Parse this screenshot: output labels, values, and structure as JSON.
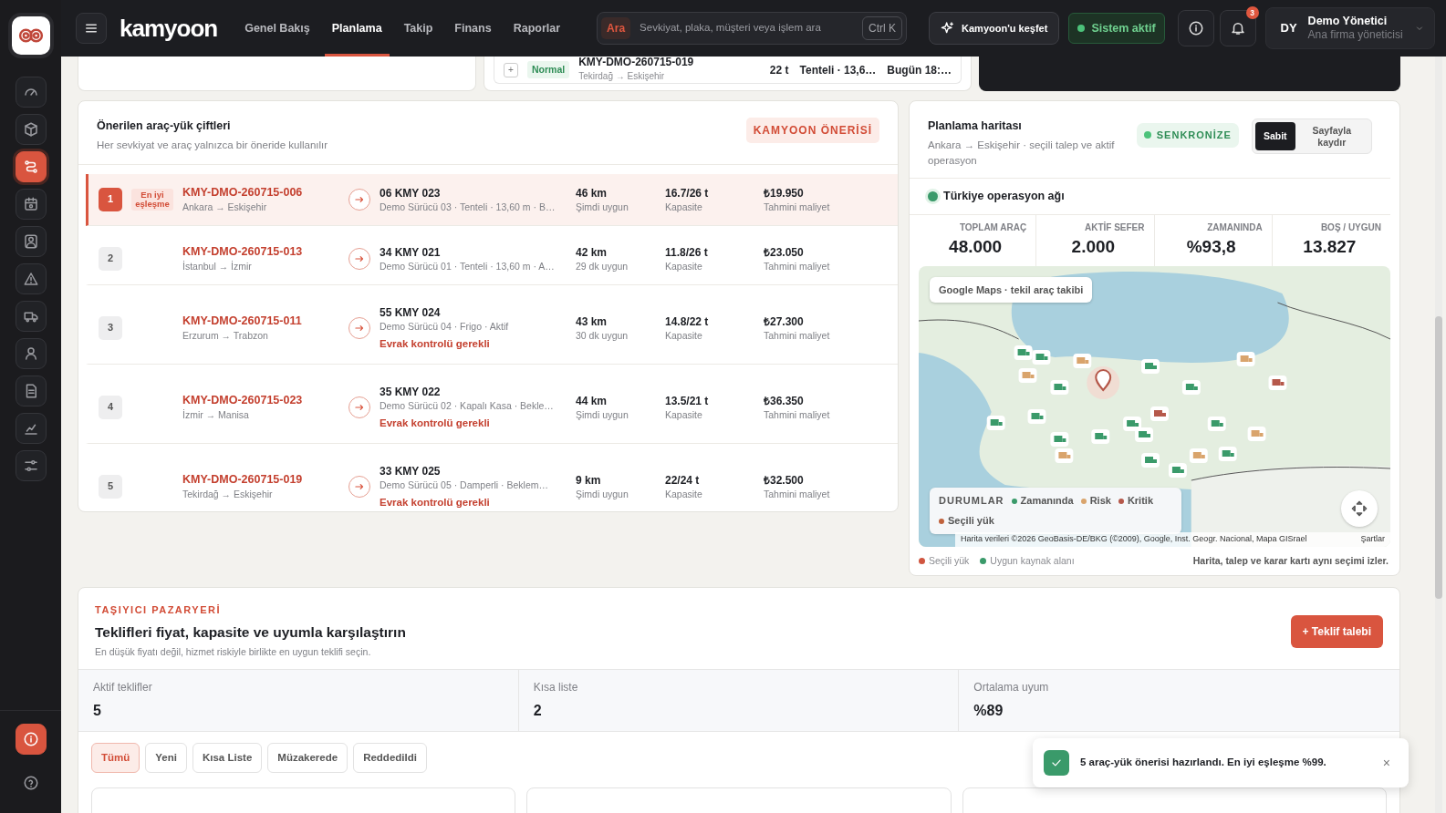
{
  "sidebar": {
    "items": [
      {
        "selected": false
      },
      {
        "selected": false
      },
      {
        "selected": true
      },
      {
        "selected": false
      },
      {
        "selected": false
      },
      {
        "selected": false
      },
      {
        "selected": false
      },
      {
        "selected": false
      },
      {
        "selected": false
      },
      {
        "selected": false
      },
      {
        "selected": false
      }
    ],
    "footer_items": [
      {
        "kind": "alert"
      },
      {
        "kind": "help"
      }
    ]
  },
  "topbar": {
    "brand": "kamyoon",
    "tabs": [
      {
        "label": "Genel Bakış",
        "selected": false
      },
      {
        "label": "Planlama",
        "selected": true
      },
      {
        "label": "Takip",
        "selected": false
      },
      {
        "label": "Finans",
        "selected": false
      },
      {
        "label": "Raporlar",
        "selected": false
      }
    ],
    "search": {
      "button": "Ara",
      "placeholder": "Sevkiyat, plaka, müşteri veya işlem ara",
      "shortcut": "Ctrl K"
    },
    "explore_button": "Kamyoon'u keşfet",
    "status": "Sistem aktif",
    "notification_count": "3",
    "user": {
      "initials": "DY",
      "name": "Demo Yönetici",
      "role": "Ana firma yöneticisi"
    }
  },
  "shipment_strip": {
    "add": "+",
    "priority": "Normal",
    "id": "KMY-DMO-260715-019",
    "route": "Tekirdağ → Eskişehir",
    "weight": "22 t",
    "vehicle_type": "Tenteli · 13,6…",
    "time": "Bugün 18:…"
  },
  "suggestions": {
    "title": "Önerilen araç-yük çiftleri",
    "subtitle": "Her sevkiyat ve araç yalnızca bir öneride kullanılır",
    "badge": "KAMYOON ÖNERİSİ",
    "rows": [
      {
        "rank": "1",
        "selected": true,
        "tag": "En iyi eşleşme",
        "shipment_id": "KMY-DMO-260715-006",
        "route": "Ankara → Eskişehir",
        "plate": "06 KMY 023",
        "details": "Demo Sürücü 03 · Tenteli · 13,60 m · B…",
        "distance": "46 km",
        "availability": "Şimdi uygun",
        "capacity": "16.7/26 t",
        "capacity_label": "Kapasite",
        "cost": "₺19.950",
        "cost_label": "Tahmini maliyet"
      },
      {
        "rank": "2",
        "selected": false,
        "shipment_id": "KMY-DMO-260715-013",
        "route": "İstanbul → İzmir",
        "plate": "34 KMY 021",
        "details": "Demo Sürücü 01 · Tenteli · 13,60 m · A…",
        "distance": "42 km",
        "availability": "29 dk uygun",
        "capacity": "11.8/26 t",
        "capacity_label": "Kapasite",
        "cost": "₺23.050",
        "cost_label": "Tahmini maliyet"
      },
      {
        "rank": "3",
        "selected": false,
        "shipment_id": "KMY-DMO-260715-011",
        "route": "Erzurum → Trabzon",
        "plate": "55 KMY 024",
        "details": "Demo Sürücü 04 · Frigo · Aktif",
        "warning": "Evrak kontrolü gerekli",
        "distance": "43 km",
        "availability": "30 dk uygun",
        "capacity": "14.8/22 t",
        "capacity_label": "Kapasite",
        "cost": "₺27.300",
        "cost_label": "Tahmini maliyet"
      },
      {
        "rank": "4",
        "selected": false,
        "shipment_id": "KMY-DMO-260715-023",
        "route": "İzmir → Manisa",
        "plate": "35 KMY 022",
        "details": "Demo Sürücü 02 · Kapalı Kasa · Bekle…",
        "warning": "Evrak kontrolü gerekli",
        "distance": "44 km",
        "availability": "Şimdi uygun",
        "capacity": "13.5/21 t",
        "capacity_label": "Kapasite",
        "cost": "₺36.350",
        "cost_label": "Tahmini maliyet"
      },
      {
        "rank": "5",
        "selected": false,
        "shipment_id": "KMY-DMO-260715-019",
        "route": "Tekirdağ → Eskişehir",
        "plate": "33 KMY 025",
        "details": "Demo Sürücü 05 · Damperli · Beklem…",
        "warning": "Evrak kontrolü gerekli",
        "distance": "9 km",
        "availability": "Şimdi uygun",
        "capacity": "22/24 t",
        "capacity_label": "Kapasite",
        "cost": "₺32.500",
        "cost_label": "Tahmini maliyet"
      }
    ]
  },
  "map_panel": {
    "title": "Planlama haritası",
    "subtitle": "Ankara → Eskişehir · seçili talep ve aktif operasyon",
    "sync_badge": "SENKRONİZE",
    "view_toggle": [
      {
        "label": "Sabit",
        "selected": true
      },
      {
        "label": "Sayfayla kaydır",
        "selected": false
      }
    ],
    "network_label": "Türkiye operasyon ağı",
    "stats": [
      {
        "label": "TOPLAM ARAÇ",
        "value": "48.000"
      },
      {
        "label": "AKTİF SEFER",
        "value": "2.000"
      },
      {
        "label": "ZAMANINDA",
        "value": "%93,8"
      },
      {
        "label": "BOŞ / UYGUN",
        "value": "13.827"
      }
    ],
    "map_chip": "Google Maps · tekil araç takibi",
    "legend": {
      "title": "DURUMLAR",
      "items": [
        {
          "label": "Zamanında",
          "color": "#3a9a6a"
        },
        {
          "label": "Risk",
          "color": "#d9a46c"
        },
        {
          "label": "Kritik",
          "color": "#b5584a"
        },
        {
          "label": "Seçili yük",
          "color": "#c0623c"
        }
      ]
    },
    "attribution": "Harita verileri ©2026 GeoBasis-DE/BKG (©2009), Google, Inst. Geogr. Nacional, Mapa GISrael",
    "terms": "Şartlar",
    "footer_legend": [
      {
        "label": "Seçili yük",
        "color": "#d0553f"
      },
      {
        "label": "Uygun kaynak alanı",
        "color": "#3a9a6a"
      }
    ],
    "footer_note": "Harita, talep ve karar kartı aynı seçimi izler."
  },
  "marketplace": {
    "eyebrow": "TAŞIYICI PAZARYERİ",
    "title": "Teklifleri fiyat, kapasite ve uyumla karşılaştırın",
    "subtitle": "En düşük fiyatı değil, hizmet riskiyle birlikte en uygun teklifi seçin.",
    "action": "+ Teklif talebi",
    "stats": [
      {
        "label": "Aktif teklifler",
        "value": "5"
      },
      {
        "label": "Kısa liste",
        "value": "2"
      },
      {
        "label": "Ortalama uyum",
        "value": "%89"
      }
    ],
    "filters": [
      {
        "label": "Tümü",
        "selected": true
      },
      {
        "label": "Yeni",
        "selected": false
      },
      {
        "label": "Kısa Liste",
        "selected": false
      },
      {
        "label": "Müzakerede",
        "selected": false
      },
      {
        "label": "Reddedildi",
        "selected": false
      }
    ]
  },
  "toast": {
    "message": "5 araç-yük önerisi hazırlandı. En iyi eşleşme %99.",
    "close": "×"
  }
}
